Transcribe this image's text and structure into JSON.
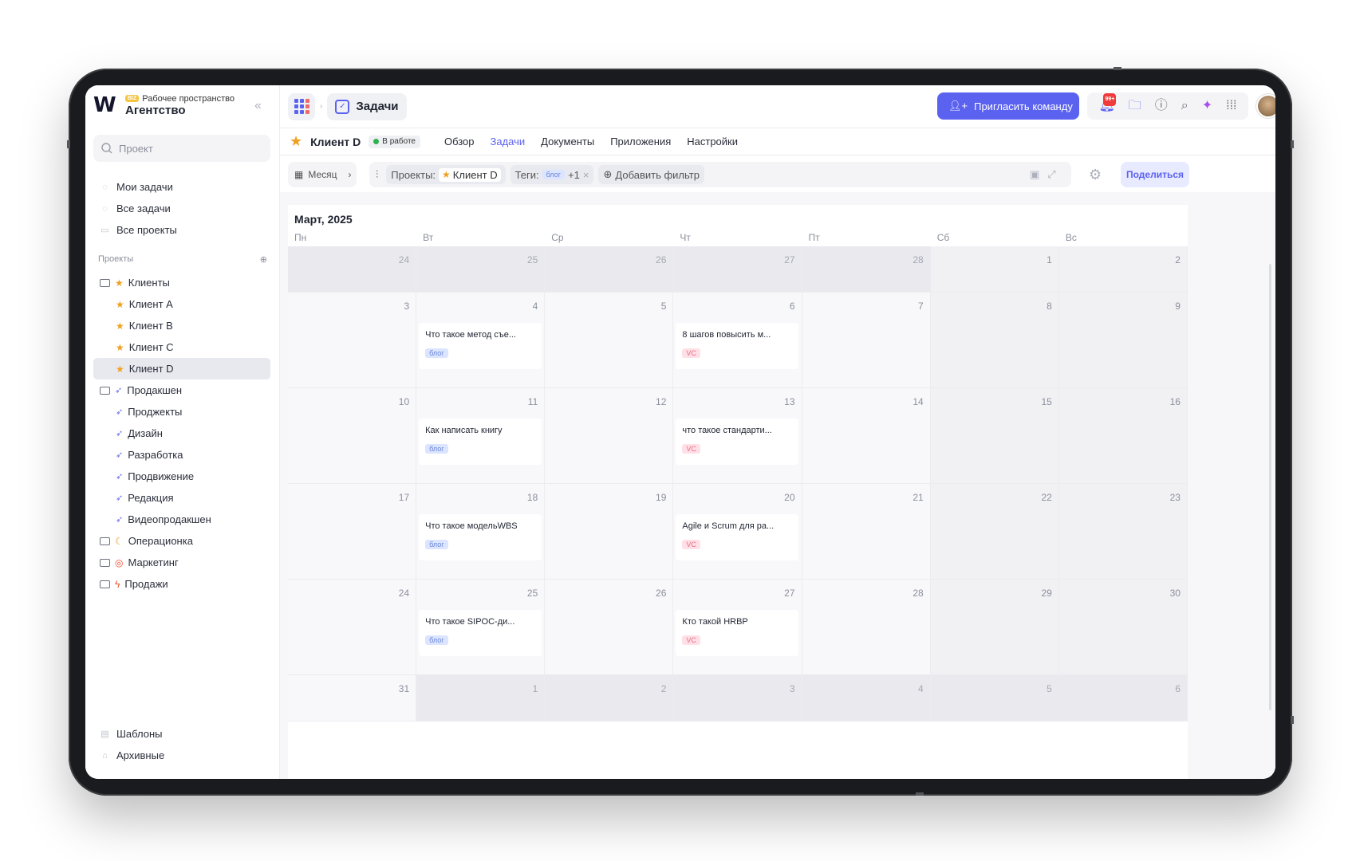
{
  "workspace": {
    "badge": "BIZ",
    "label": "Рабочее пространство",
    "name": "Агентство"
  },
  "search": {
    "placeholder": "Проект"
  },
  "nav": [
    {
      "label": "Мои задачи"
    },
    {
      "label": "Все задачи"
    },
    {
      "label": "Все проекты"
    }
  ],
  "projects_header": "Проекты",
  "tree": [
    {
      "label": "Клиенты",
      "kind": "folder",
      "icon": "star"
    },
    {
      "label": "Клиент A",
      "kind": "child",
      "icon": "star"
    },
    {
      "label": "Клиент B",
      "kind": "child",
      "icon": "star"
    },
    {
      "label": "Клиент C",
      "kind": "child",
      "icon": "star"
    },
    {
      "label": "Клиент D",
      "kind": "child",
      "icon": "star",
      "selected": true
    },
    {
      "label": "Продакшен",
      "kind": "folder",
      "icon": "rocket"
    },
    {
      "label": "Проджекты",
      "kind": "child",
      "icon": "rocket"
    },
    {
      "label": "Дизайн",
      "kind": "child",
      "icon": "rocket"
    },
    {
      "label": "Разработка",
      "kind": "child",
      "icon": "rocket"
    },
    {
      "label": "Продвижение",
      "kind": "child",
      "icon": "rocket"
    },
    {
      "label": "Редакция",
      "kind": "child",
      "icon": "rocket"
    },
    {
      "label": "Видеопродакшен",
      "kind": "child",
      "icon": "rocket"
    },
    {
      "label": "Операционка",
      "kind": "folder",
      "icon": "moon"
    },
    {
      "label": "Маркетинг",
      "kind": "folder",
      "icon": "target"
    },
    {
      "label": "Продажи",
      "kind": "folder",
      "icon": "bolt"
    }
  ],
  "bottom_nav": [
    {
      "label": "Шаблоны"
    },
    {
      "label": "Архивные"
    }
  ],
  "topbar": {
    "section": "Задачи",
    "invite": "Пригласить команду",
    "notif_badge": "99+"
  },
  "project": {
    "name": "Клиент D",
    "status": "В работе",
    "tabs": [
      "Обзор",
      "Задачи",
      "Документы",
      "Приложения",
      "Настройки"
    ],
    "active_tab": 1
  },
  "filters": {
    "view": "Месяц",
    "projects_label": "Проекты:",
    "project_value": "Клиент D",
    "tags_label": "Теги:",
    "tag_value": "блог",
    "tag_more": "+1",
    "add_filter": "Добавить фильтр",
    "share": "Поделиться"
  },
  "calendar": {
    "title": "Март, 2025",
    "weekdays": [
      "Пн",
      "Вт",
      "Ср",
      "Чт",
      "Пт",
      "Сб",
      "Вс"
    ],
    "weeks": [
      [
        {
          "d": "24",
          "out": true
        },
        {
          "d": "25",
          "out": true
        },
        {
          "d": "26",
          "out": true
        },
        {
          "d": "27",
          "out": true
        },
        {
          "d": "28",
          "out": true
        },
        {
          "d": "1"
        },
        {
          "d": "2"
        }
      ],
      [
        {
          "d": "3"
        },
        {
          "d": "4",
          "task": "Что такое метод съе...",
          "tag": "блог"
        },
        {
          "d": "5"
        },
        {
          "d": "6",
          "task": "8 шагов повысить м...",
          "tag": "VC"
        },
        {
          "d": "7"
        },
        {
          "d": "8"
        },
        {
          "d": "9"
        }
      ],
      [
        {
          "d": "10"
        },
        {
          "d": "11",
          "task": "Как написать книгу",
          "tag": "блог"
        },
        {
          "d": "12"
        },
        {
          "d": "13",
          "task": "что такое стандарти...",
          "tag": "VC"
        },
        {
          "d": "14"
        },
        {
          "d": "15"
        },
        {
          "d": "16"
        }
      ],
      [
        {
          "d": "17"
        },
        {
          "d": "18",
          "task": "Что такое модельWBS",
          "tag": "блог"
        },
        {
          "d": "19"
        },
        {
          "d": "20",
          "task": "Agile и Scrum для ра...",
          "tag": "VC"
        },
        {
          "d": "21"
        },
        {
          "d": "22"
        },
        {
          "d": "23"
        }
      ],
      [
        {
          "d": "24"
        },
        {
          "d": "25",
          "task": "Что такое SIPOC-ди...",
          "tag": "блог"
        },
        {
          "d": "26"
        },
        {
          "d": "27",
          "task": "Кто такой HRBP",
          "tag": "VC"
        },
        {
          "d": "28"
        },
        {
          "d": "29"
        },
        {
          "d": "30"
        }
      ],
      [
        {
          "d": "31"
        },
        {
          "d": "1",
          "out": true
        },
        {
          "d": "2",
          "out": true
        },
        {
          "d": "3",
          "out": true
        },
        {
          "d": "4",
          "out": true
        },
        {
          "d": "5",
          "out": true
        },
        {
          "d": "6",
          "out": true
        }
      ]
    ]
  }
}
